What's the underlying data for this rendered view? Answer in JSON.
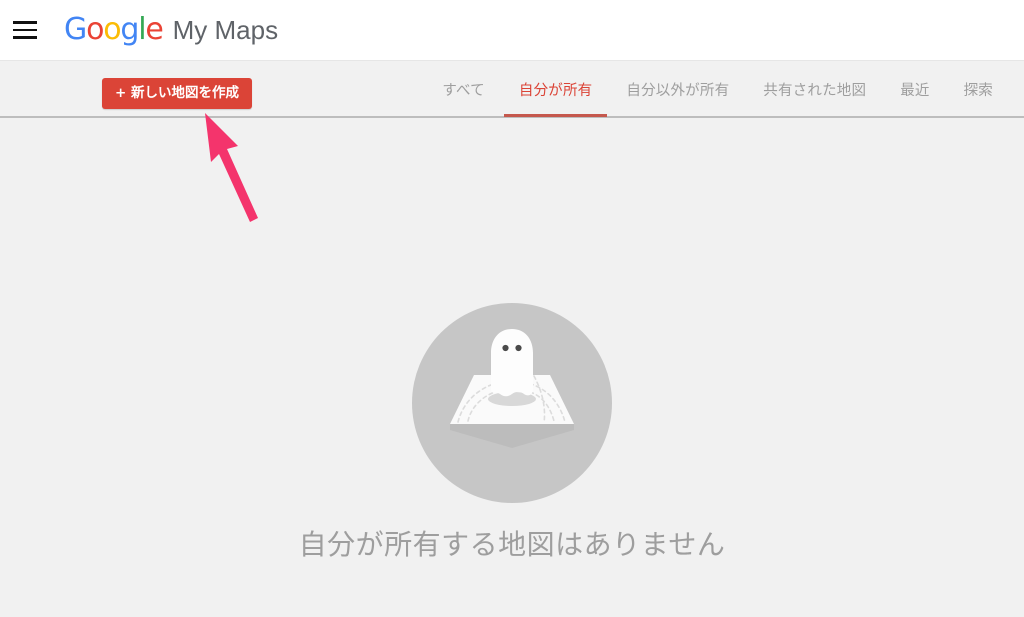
{
  "header": {
    "menu_icon": "hamburger-menu-icon",
    "logo": {
      "letters": [
        "G",
        "o",
        "o",
        "g",
        "l",
        "e"
      ],
      "colors": [
        "#4285F4",
        "#EA4335",
        "#FBBC05",
        "#4285F4",
        "#34A853",
        "#EA4335"
      ]
    },
    "product_name": "My Maps"
  },
  "toolbar": {
    "create_button_label": "+ 新しい地図を作成",
    "create_button_color": "#db4437",
    "tabs": [
      {
        "label": "すべて",
        "active": false
      },
      {
        "label": "自分が所有",
        "active": true
      },
      {
        "label": "自分以外が所有",
        "active": false
      },
      {
        "label": "共有された地図",
        "active": false
      },
      {
        "label": "最近",
        "active": false
      },
      {
        "label": "探索",
        "active": false
      }
    ],
    "active_tab_index": 1,
    "active_tab_color": "#db4437"
  },
  "main": {
    "empty_state": {
      "illustration_name": "ghost-on-map-illustration",
      "message": "自分が所有する地図はありません",
      "message_color": "#9e9e9e",
      "circle_color": "#c6c6c6"
    }
  },
  "annotation": {
    "arrow_name": "pink-pointer-arrow",
    "arrow_color": "#f4346c",
    "points_to": "create_button"
  },
  "colors": {
    "page_background": "#f1f1f1",
    "header_background": "#ffffff",
    "accent_red": "#db4437",
    "text_gray": "#5f6368"
  }
}
